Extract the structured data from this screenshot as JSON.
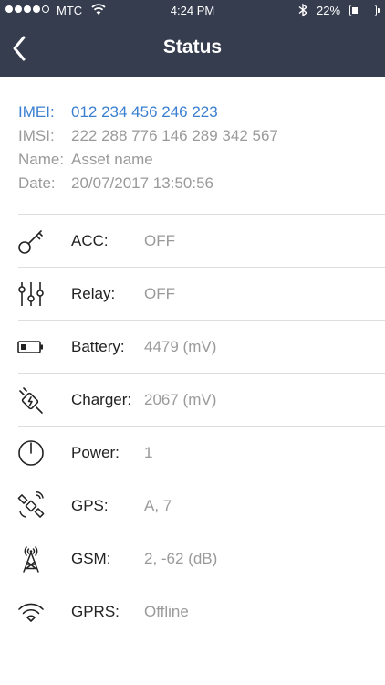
{
  "status_bar": {
    "carrier": "MTC",
    "time": "4:24 PM",
    "battery": "22%"
  },
  "header": {
    "title": "Status"
  },
  "info": [
    {
      "key": "IMEI:",
      "value": "012 234 456 246 223"
    },
    {
      "key": "IMSI:",
      "value": "222 288 776 146 289 342 567"
    },
    {
      "key": "Name:",
      "value": "Asset name"
    },
    {
      "key": "Date:",
      "value": "20/07/2017  13:50:56"
    }
  ],
  "rows": [
    {
      "label": "ACC:",
      "value": "OFF",
      "icon": "key-icon"
    },
    {
      "label": "Relay:",
      "value": "OFF",
      "icon": "sliders-icon"
    },
    {
      "label": "Battery:",
      "value": "4479 (mV)",
      "icon": "battery-icon"
    },
    {
      "label": "Charger:",
      "value": "2067 (mV)",
      "icon": "charger-plug-icon"
    },
    {
      "label": "Power:",
      "value": "1",
      "icon": "power-icon"
    },
    {
      "label": "GPS:",
      "value": "A, 7",
      "icon": "satellite-icon"
    },
    {
      "label": "GSM:",
      "value": "2, -62 (dB)",
      "icon": "antenna-tower-icon"
    },
    {
      "label": "GPRS:",
      "value": "Offline",
      "icon": "wifi-icon"
    }
  ]
}
